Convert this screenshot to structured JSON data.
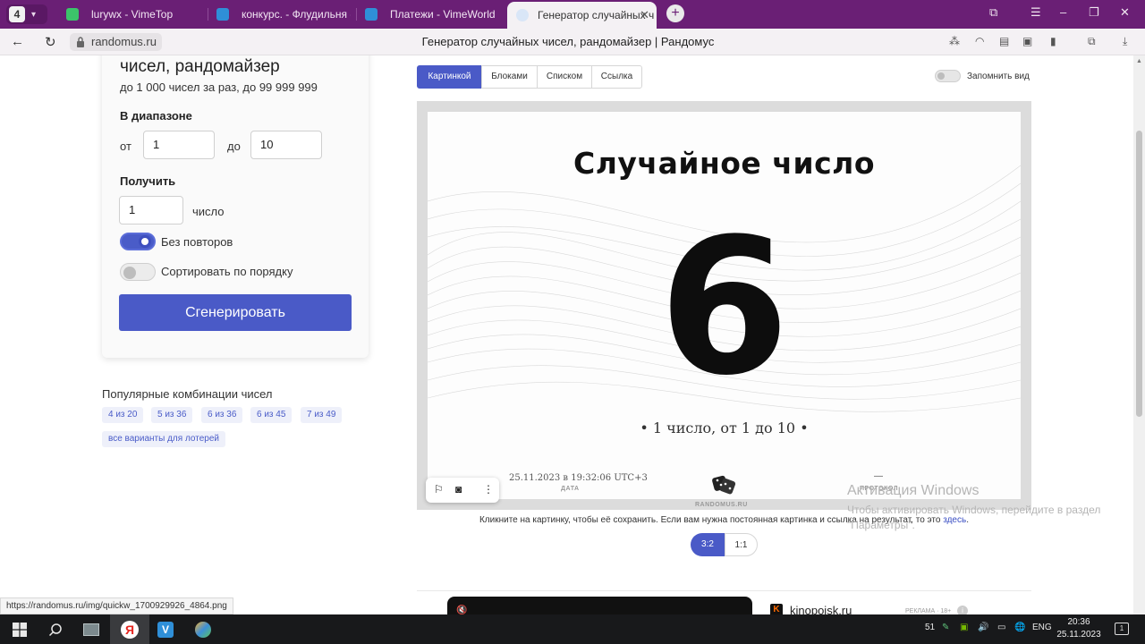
{
  "browser": {
    "tab_count": "4",
    "tabs": [
      {
        "title": "lurywx - VimeTop",
        "color": "#3cc46a"
      },
      {
        "title": "конкурс. - Флудильня - Vi",
        "color": "#2f8fd8"
      },
      {
        "title": "Платежи - VimeWorld",
        "color": "#2f8fd8"
      },
      {
        "title": "Генератор случайных ч",
        "color": "#4a5ac7",
        "active": true
      }
    ],
    "url": "randomus.ru",
    "page_title": "Генератор случайных чисел, рандомайзер | Рандомус"
  },
  "generator": {
    "heading": "чисел, рандомайзер",
    "subheading": "до 1 000 чисел за раз, до 99 999 999",
    "range_label": "В диапазоне",
    "from_label": "от",
    "from_value": "1",
    "to_label": "до",
    "to_value": "10",
    "get_label": "Получить",
    "count_value": "1",
    "count_unit": "число",
    "no_repeat_label": "Без повторов",
    "no_repeat_on": true,
    "sort_label": "Сортировать по порядку",
    "sort_on": false,
    "generate_button": "Сгенерировать"
  },
  "popular": {
    "title": "Популярные комбинации чисел",
    "chips": [
      "4 из 20",
      "5 из 36",
      "6 из 36",
      "6 из 45",
      "7 из 49"
    ],
    "all_label": "все варианты для лотерей"
  },
  "view": {
    "tabs": [
      "Картинкой",
      "Блоками",
      "Списком",
      "Ссылка"
    ],
    "active_tab": "Картинкой",
    "remember_label": "Запомнить вид"
  },
  "result": {
    "title": "Случайное число",
    "number": "6",
    "description": "•  1 число, от 1 до 10  •",
    "datetime": "25.11.2023 в 19:32:06 UTC+3",
    "date_label": "ДАТА",
    "protocol_value": "—",
    "protocol_label": "ПРОТОКОЛ",
    "brand": "RANDOMUS.RU"
  },
  "note": {
    "text": "Кликните на картинку, чтобы её сохранить. Если вам нужна постоянная картинка и ссылка на результат, то это ",
    "link": "здесь",
    "end": "."
  },
  "ratios": [
    "3:2",
    "1:1"
  ],
  "activation": {
    "title": "Активация Windows",
    "line1": "Чтобы активировать Windows, перейдите в раздел",
    "line2": "\"Параметры\"."
  },
  "ad": {
    "name": "kinopoisk.ru",
    "tag": "РЕКЛАМА · 18+"
  },
  "status_url": "https://randomus.ru/img/quickw_1700929926_4864.png",
  "taskbar": {
    "tray_count": "51",
    "lang": "ENG",
    "time": "20:36",
    "date": "25.11.2023",
    "notifications": "1"
  },
  "colors": {
    "accent": "#4a5ac7",
    "tabbar": "#6a1f75",
    "taskbar": "#18191b"
  }
}
